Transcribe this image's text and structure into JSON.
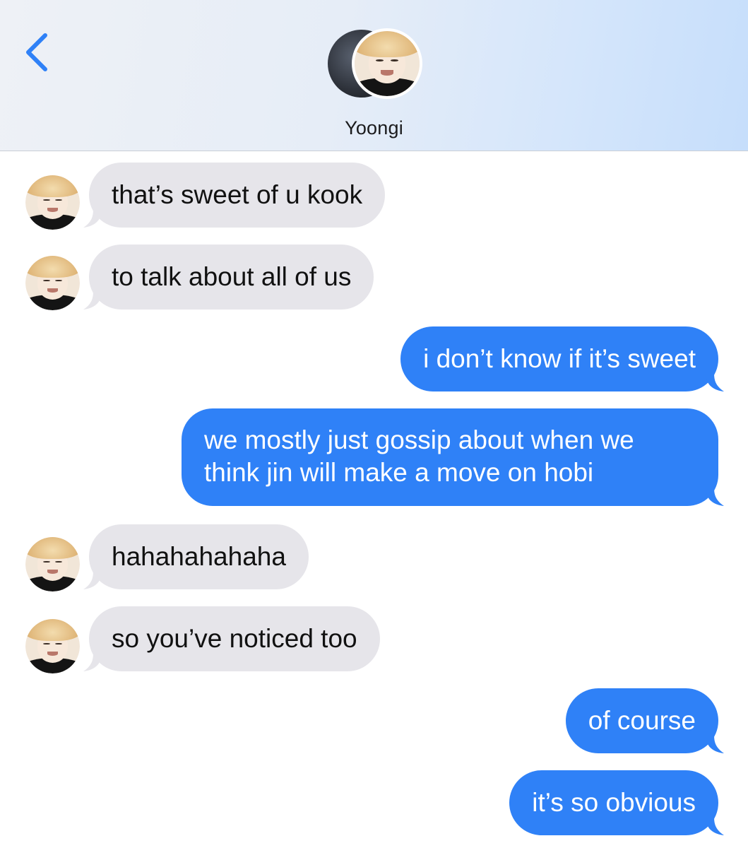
{
  "header": {
    "back_icon": "chevron-left-icon",
    "contact_name": "Yoongi",
    "accent": "#2f81f7"
  },
  "colors": {
    "incoming_bubble": "#e6e5ea",
    "outgoing_bubble": "#2f81f7"
  },
  "messages": [
    {
      "direction": "incoming",
      "text": "that’s sweet of u kook"
    },
    {
      "direction": "incoming",
      "text": "to talk about all of us"
    },
    {
      "direction": "outgoing",
      "text": "i don’t know if it’s sweet"
    },
    {
      "direction": "outgoing",
      "text": "we mostly just gossip about when we think jin will make a move on hobi"
    },
    {
      "direction": "incoming",
      "text": "hahahahahaha"
    },
    {
      "direction": "incoming",
      "text": "so you’ve noticed too"
    },
    {
      "direction": "outgoing",
      "text": "of course"
    },
    {
      "direction": "outgoing",
      "text": "it’s so obvious"
    }
  ]
}
